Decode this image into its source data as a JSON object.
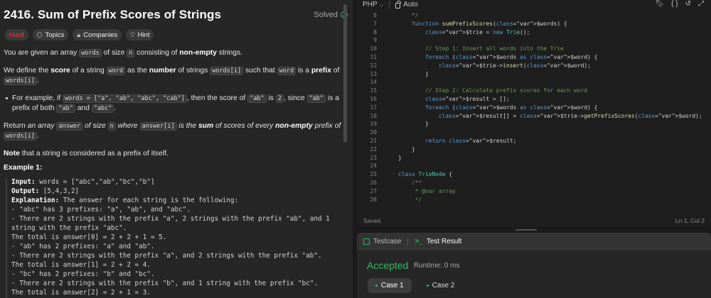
{
  "problem": {
    "title": "2416. Sum of Prefix Scores of Strings",
    "solved_label": "Solved",
    "tags": [
      "Hard",
      "Topics",
      "Companies",
      "Hint"
    ]
  },
  "description": {
    "p1": [
      "You are given an array ",
      "words",
      " of size ",
      "n",
      " consisting of ",
      "non-empty",
      " strings."
    ],
    "p2": [
      "We define the ",
      "score",
      " of a string ",
      "word",
      " as the ",
      "number",
      " of strings ",
      "words[i]",
      " such that ",
      "word",
      " is a ",
      "prefix",
      " of ",
      "words[i]",
      "."
    ],
    "bullet": [
      "For example, if ",
      "words = [\"a\", \"ab\", \"abc\", \"cab\"]",
      ", then the score of ",
      "\"ab\"",
      " is ",
      "2",
      ", since ",
      "\"ab\"",
      " is a prefix of both ",
      "\"ab\"",
      " and ",
      "\"abc\"",
      "."
    ],
    "p3": [
      "Return ",
      "an array ",
      "answer",
      " of size ",
      "n",
      " where ",
      "answer[i]",
      " is the ",
      "sum",
      " of scores of every ",
      "non-empty",
      " prefix of ",
      "words[i]",
      "."
    ],
    "p4": [
      "Note",
      " that a string is considered as a prefix of itself."
    ]
  },
  "example": {
    "title": "Example 1:",
    "input_label": "Input:",
    "input_value": " words = [\"abc\",\"ab\",\"bc\",\"b\"]",
    "output_label": "Output:",
    "output_value": " [5,4,3,2]",
    "explanation_label": "Explanation:",
    "explanation_lines": [
      " The answer for each string is the following:",
      "- \"abc\" has 3 prefixes: \"a\", \"ab\", and \"abc\".",
      "- There are 2 strings with the prefix \"a\", 2 strings with the prefix \"ab\", and 1",
      "string with the prefix \"abc\".",
      "The total is answer[0] = 2 + 2 + 1 = 5.",
      "- \"ab\" has 2 prefixes: \"a\" and \"ab\".",
      "- There are 2 strings with the prefix \"a\", and 2 strings with the prefix \"ab\".",
      "The total is answer[1] = 2 + 2 = 4.",
      "- \"bc\" has 2 prefixes: \"b\" and \"bc\".",
      "- There are 2 strings with the prefix \"b\", and 1 string with the prefix \"bc\".",
      "The total is answer[2] = 2 + 1 = 3."
    ]
  },
  "editor": {
    "language": "PHP",
    "mode": "Auto",
    "status_saved": "Saved",
    "cursor_position": "Ln 1, Col 2",
    "lines": [
      {
        "n": "6",
        "text": "    */"
      },
      {
        "n": "7",
        "text": "    function sumPrefixScores($words) {"
      },
      {
        "n": "8",
        "text": "        $trie = new Trie();"
      },
      {
        "n": "9",
        "text": ""
      },
      {
        "n": "10",
        "text": "        // Step 1: Insert all words into the Trie"
      },
      {
        "n": "11",
        "text": "        foreach ($words as $word) {"
      },
      {
        "n": "12",
        "text": "            $trie->insert($word);"
      },
      {
        "n": "13",
        "text": "        }"
      },
      {
        "n": "14",
        "text": ""
      },
      {
        "n": "15",
        "text": "        // Step 2: Calculate prefix scores for each word"
      },
      {
        "n": "16",
        "text": "        $result = [];"
      },
      {
        "n": "17",
        "text": "        foreach ($words as $word) {"
      },
      {
        "n": "18",
        "text": "            $result[] = $trie->getPrefixScores($word);"
      },
      {
        "n": "19",
        "text": "        }"
      },
      {
        "n": "20",
        "text": ""
      },
      {
        "n": "21",
        "text": "        return $result;"
      },
      {
        "n": "22",
        "text": "    }"
      },
      {
        "n": "23",
        "text": "}"
      },
      {
        "n": "24",
        "text": ""
      },
      {
        "n": "25",
        "text": "class TrieNode {"
      },
      {
        "n": "26",
        "text": "    /**"
      },
      {
        "n": "27",
        "text": "     * @var array"
      },
      {
        "n": "28",
        "text": "     */"
      }
    ]
  },
  "results": {
    "tab_testcase": "Testcase",
    "tab_test_result": "Test Result",
    "status": "Accepted",
    "runtime": "Runtime: 0 ms",
    "cases": [
      "Case 1",
      "Case 2"
    ]
  },
  "colors": {
    "accent_green": "#2cbb5d",
    "hard_red": "#f63737",
    "panel_bg": "#262626",
    "editor_bg": "#1e1e1e"
  }
}
